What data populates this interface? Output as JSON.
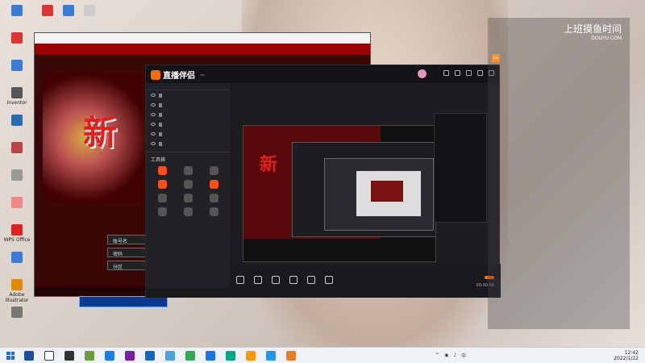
{
  "desktop": {
    "icons": [
      {
        "label": "",
        "color": "#3a7bd5"
      },
      {
        "label": "",
        "color": "#d33"
      },
      {
        "label": "",
        "color": "#3a7bd5"
      },
      {
        "label": "Inventor",
        "color": "#555"
      },
      {
        "label": "",
        "color": "#2b6cb0"
      },
      {
        "label": "",
        "color": "#b44"
      },
      {
        "label": "",
        "color": "#999"
      },
      {
        "label": "",
        "color": "#e88"
      },
      {
        "label": "WPS Office",
        "color": "#d22"
      },
      {
        "label": "",
        "color": "#3a7bd5"
      },
      {
        "label": "Adobe Illustrator",
        "color": "#e08a00"
      },
      {
        "label": "",
        "color": "#777"
      }
    ]
  },
  "game": {
    "window_title": "",
    "banner": "",
    "big_word": "新",
    "account_label": "账号名",
    "password_label": "密码",
    "server_label": "分区",
    "notice": "",
    "login_label": "",
    "footer": ""
  },
  "main": {
    "app_name": "直播伴侣",
    "badge": "",
    "left_tabs": [
      "",
      "",
      ""
    ],
    "scenes": [
      "",
      "",
      "",
      "",
      "",
      ""
    ],
    "tools_title": "工具箱",
    "tools": [
      {
        "label": "",
        "hot": true
      },
      {
        "label": "",
        "hot": false
      },
      {
        "label": "",
        "hot": false
      },
      {
        "label": "",
        "hot": true
      },
      {
        "label": "",
        "hot": false
      },
      {
        "label": "",
        "hot": true
      },
      {
        "label": "",
        "hot": false
      },
      {
        "label": "",
        "hot": false
      },
      {
        "label": "",
        "hot": false
      },
      {
        "label": "",
        "hot": false
      },
      {
        "label": "",
        "hot": false
      },
      {
        "label": "",
        "hot": false
      }
    ],
    "footer_hint": "",
    "center_top": "",
    "center_mini": "",
    "info_tag": "",
    "info_text": "",
    "controls": [
      "",
      "",
      "",
      "",
      "",
      ""
    ],
    "go_live": "",
    "timer": "00:00:00"
  },
  "assistant": {
    "title": "",
    "stat_a": "",
    "stat_b": "",
    "stat_c": "",
    "watermark": "上班摸鱼时间",
    "watermark_sub": "DOUYU.COM",
    "line1": "",
    "welcome_prefix": "",
    "welcome_text": "",
    "para1": [
      "",
      "",
      "",
      "",
      ""
    ],
    "para2": [
      "",
      ""
    ]
  },
  "taskbar": {
    "icons": [
      "#1e4f9e",
      "#fff",
      "#333",
      "#6b9e3a",
      "#1b7be0",
      "#7b1fa2",
      "#1565c0",
      "#4aa3df",
      "#34a853",
      "#1a73e8",
      "#00a884",
      "#ff9800",
      "#2196f3",
      "#e67e22"
    ],
    "time": "12:42",
    "date": "2022/1/22"
  }
}
